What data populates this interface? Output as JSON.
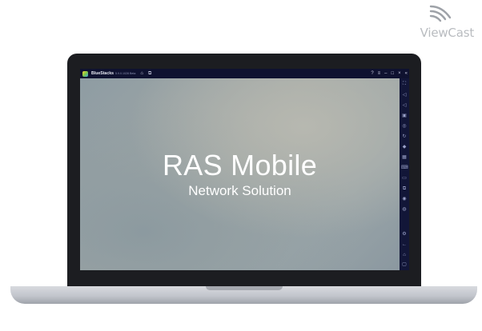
{
  "brand": {
    "name": "ViewCast",
    "icon": "wifi-waves-icon"
  },
  "window": {
    "app_name": "BlueStacks",
    "version": "5.9.0.1028 Beta",
    "top_icons": [
      "home-icon",
      "multi-instance-icon"
    ],
    "controls": [
      "help-icon",
      "menu-icon",
      "minimize-icon",
      "restore-icon",
      "close-icon",
      "collapse-sidebar-icon"
    ]
  },
  "app": {
    "title": "RAS Mobile",
    "subtitle": "Network Solution",
    "background": "#9aa5a8"
  },
  "sidebar": {
    "icons": [
      "fullscreen-icon",
      "volume-up-icon",
      "volume-down-icon",
      "screen-record-icon",
      "screenshot-icon",
      "rotate-icon",
      "shake-icon",
      "macro-icon",
      "keyboard-controls-icon",
      "folder-icon",
      "multi-instance-sync-icon",
      "eco-mode-icon",
      "location-icon",
      "settings-icon",
      "back-icon",
      "home-icon",
      "recent-apps-icon"
    ]
  },
  "colors": {
    "window_frame": "#0f1230",
    "laptop_bezel": "#1c1d21",
    "brand_gray": "#b9bcc0"
  }
}
